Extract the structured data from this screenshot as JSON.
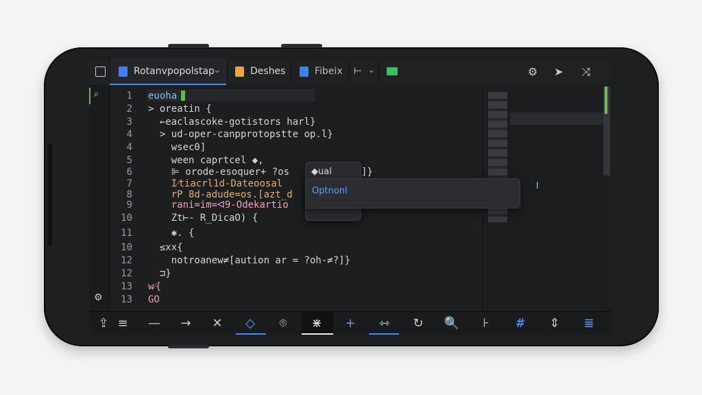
{
  "tabs": [
    {
      "label": "Rotanvpopolstap",
      "icon": "file-icon",
      "color": "#3b82f6",
      "dropdown": "⌄"
    },
    {
      "label": "Deshes",
      "icon": "folder-icon",
      "color": "#f0a33a"
    },
    {
      "label": "Fibeix",
      "icon": "file-icon",
      "color": "#3b82f6"
    },
    {
      "label": "⊢",
      "dropdown": "⌄"
    },
    {
      "label": "",
      "icon": "folder-icon",
      "color": "#3fbf5f"
    }
  ],
  "line_numbers": [
    "1",
    "2",
    "3",
    "4",
    "5",
    "6",
    "7",
    "8",
    "9",
    "10",
    "11",
    "10",
    "12",
    "12",
    "13"
  ],
  "code_lines": [
    {
      "text": "euoha",
      "cls": "c-kw"
    },
    {
      "text": "> oreatin {",
      "cls": ""
    },
    {
      "text": "  ←eaclascoke-gotistors harl}",
      "cls": ""
    },
    {
      "text": "  > ud-oper-canpprotopstte op.l}",
      "cls": ""
    },
    {
      "text": "    wsec0]",
      "cls": ""
    },
    {
      "text": "    ween caprtcel ◆,",
      "cls": ""
    },
    {
      "text": "    ⊫ orode-esoquer+ ?os",
      "cls": ""
    },
    {
      "text": "    I⁄tiacrl1d-Dateoosal",
      "cls": "c-str"
    },
    {
      "text": "    rP 8d-adude=os.[azt_d",
      "cls": "c-str"
    },
    {
      "text": "    rani=im=ᐊ9-Odekartio",
      "cls": "c-pk"
    },
    {
      "text": "    Zt⊢- R_DicaO) {",
      "cls": ""
    },
    {
      "text": "    ✱. {",
      "cls": ""
    },
    {
      "text": "  ≤xx{",
      "cls": ""
    },
    {
      "text": "    notroanew≠[aution ar = ?oh-≠?]}",
      "cls": ""
    },
    {
      "text": "  ⊐}",
      "cls": ""
    },
    {
      "text": "w⁄{",
      "cls": "c-pk"
    },
    {
      "text": "GO",
      "cls": "c-pk"
    }
  ],
  "popup_small": {
    "label": "◆ual",
    "suffix": "]}"
  },
  "popup_large": {
    "label": "Optnonl",
    "aside": "l"
  },
  "toolbar": [
    "⇪",
    "≡",
    "—",
    "→",
    "✕",
    "◇",
    "⌾",
    "⋇",
    "+",
    "⇿",
    "↻",
    "🔍",
    "⊦",
    "#",
    "⇕",
    "≣"
  ],
  "colors": {
    "accent": "#4a89ff",
    "green": "#7bb35a"
  }
}
